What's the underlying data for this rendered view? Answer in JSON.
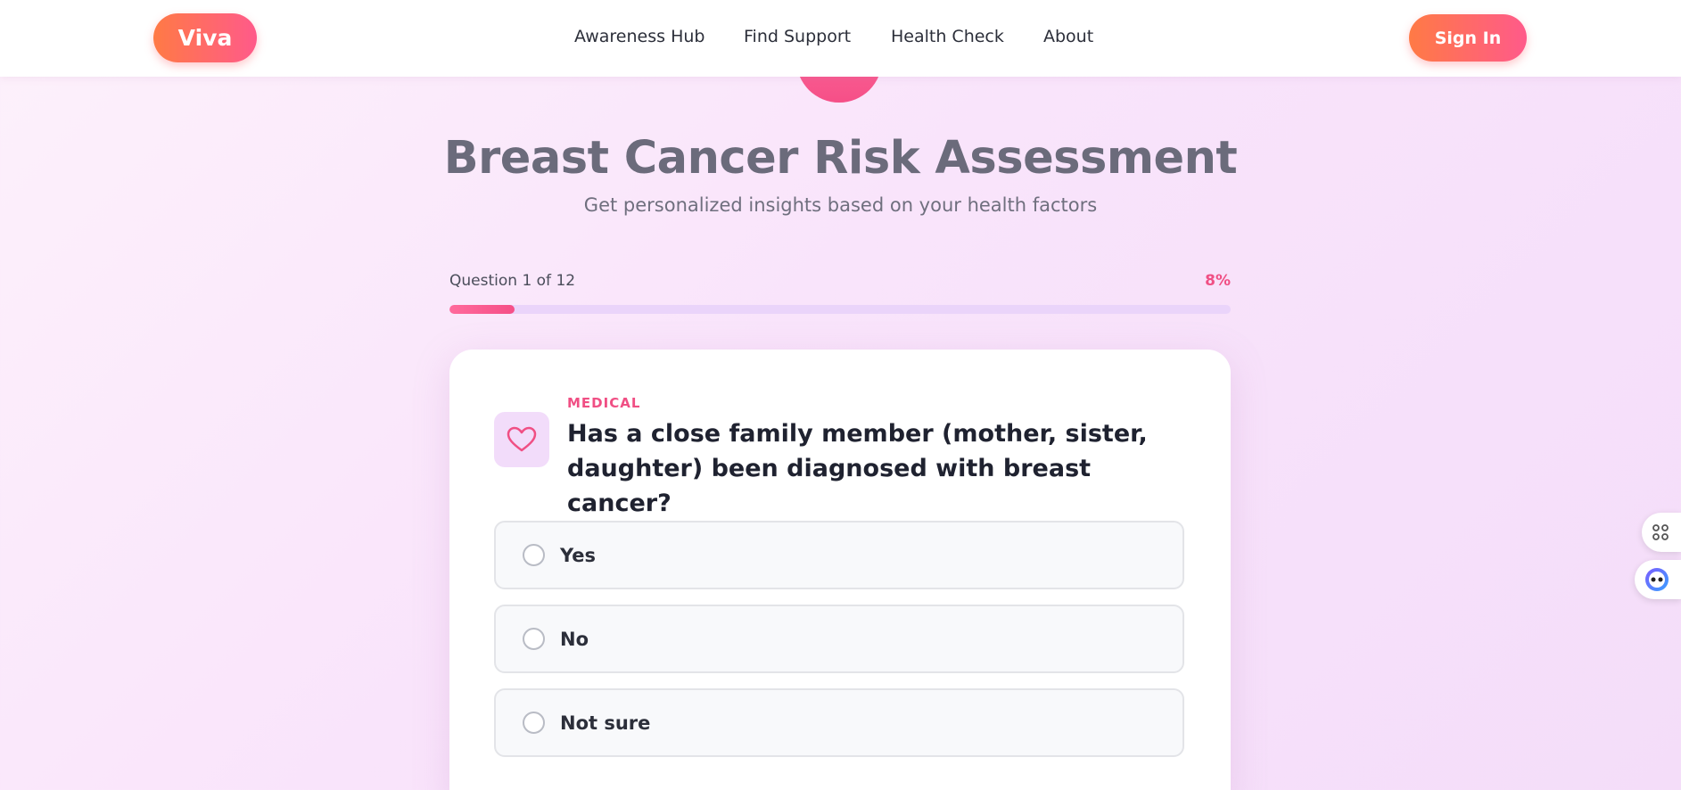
{
  "header": {
    "logo": "Viva",
    "nav": [
      "Awareness Hub",
      "Find Support",
      "Health Check",
      "About"
    ],
    "signin": "Sign In"
  },
  "page": {
    "title": "Breast Cancer Risk Assessment",
    "subtitle": "Get personalized insights based on your health factors"
  },
  "progress": {
    "label": "Question 1 of 12",
    "percent_text": "8%",
    "fraction": 0.083
  },
  "question": {
    "category": "MEDICAL",
    "text": "Has a close family member (mother, sister, daughter) been diagnosed with breast cancer?",
    "icon": "heart-icon",
    "options": [
      "Yes",
      "No",
      "Not sure"
    ]
  },
  "colors": {
    "accent": "#f04f84",
    "gradient_start": "#ff7a45",
    "gradient_end": "#ff5a8a",
    "progress_track": "#ead4fa"
  },
  "side_widgets": [
    "command-icon",
    "assistant-icon"
  ]
}
